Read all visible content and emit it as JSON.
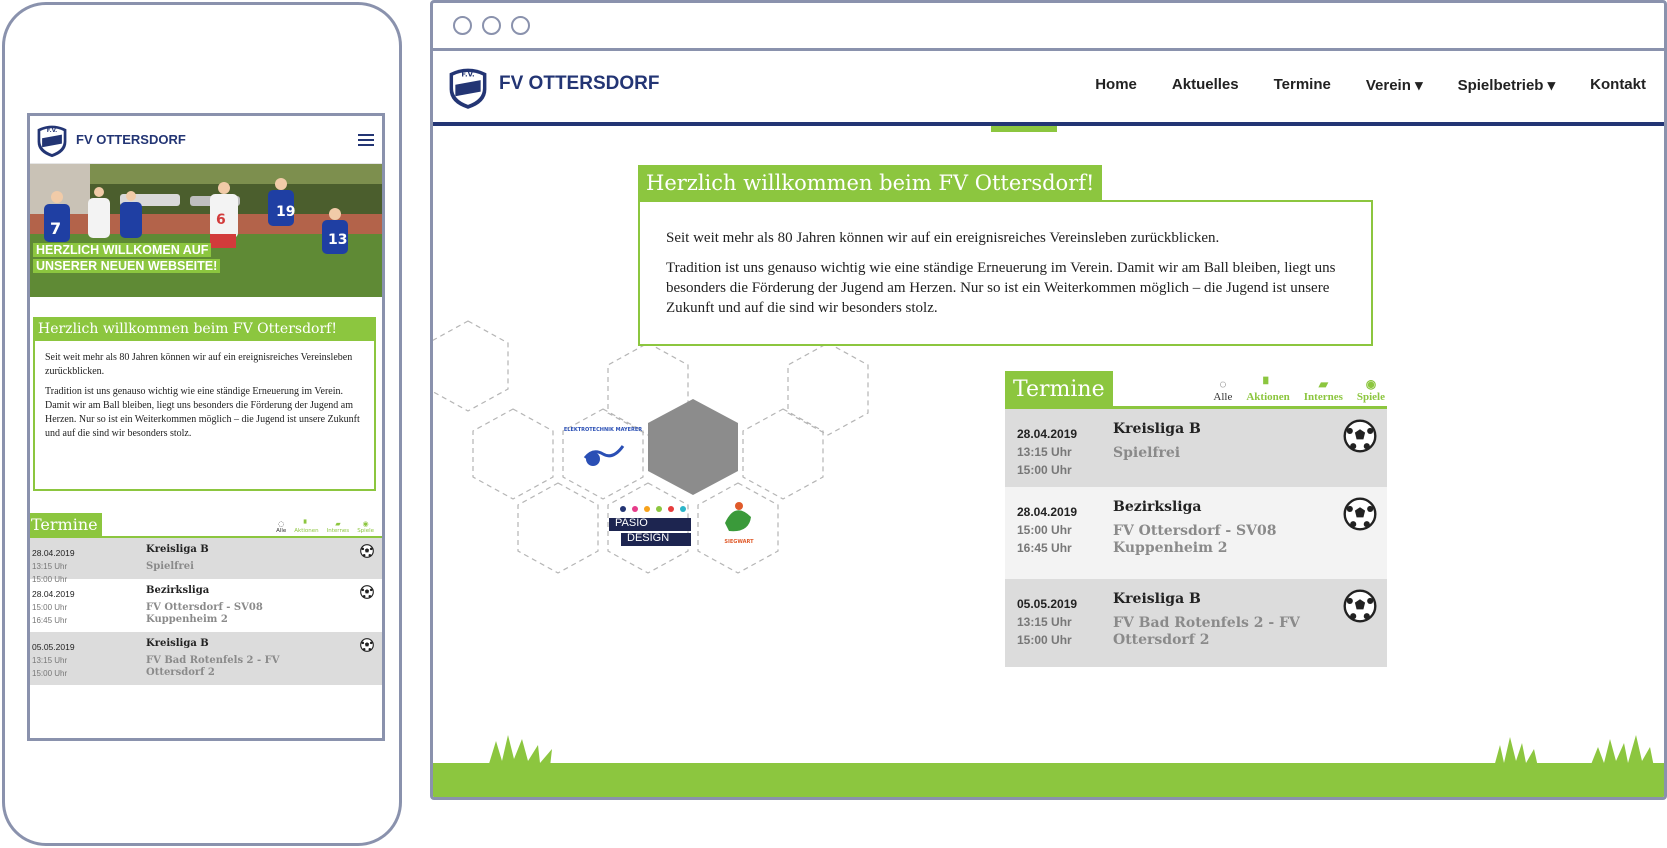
{
  "brand": {
    "name": "FV OTTERSDORF",
    "accent": "#8cc63f",
    "primary": "#233574"
  },
  "mobile": {
    "hero_title": "HERZLICH WILLKOMEN AUF UNSERER NEUEN WEBSEITE!",
    "welcome": {
      "title": "Herzlich willkommen beim FV Ottersdorf!",
      "p1": "Seit weit mehr als 80 Jahren können wir auf ein ereignisreiches Vereinsleben zurückblicken.",
      "p2": "Tradition ist uns genauso wichtig wie eine ständige Erneuerung im Verein. Damit wir am Ball bleiben, liegt uns besonders die Förderung der Jugend am Herzen. Nur so ist ein Weiterkommen möglich – die Jugend ist unsere Zukunft und auf die sind wir besonders stolz."
    },
    "termine_title": "Termine",
    "filters": [
      {
        "label": "Alle",
        "icon": "spinner-icon"
      },
      {
        "label": "Aktionen",
        "icon": "jersey-icon"
      },
      {
        "label": "Internes",
        "icon": "chat-icon"
      },
      {
        "label": "Spiele",
        "icon": "ball-icon"
      }
    ],
    "events": [
      {
        "date": "28.04.2019",
        "time1": "13:15 Uhr",
        "time2": "15:00 Uhr",
        "league": "Kreisliga B",
        "match": "Spielfrei"
      },
      {
        "date": "28.04.2019",
        "time1": "15:00 Uhr",
        "time2": "16:45 Uhr",
        "league": "Bezirksliga",
        "match": "FV Ottersdorf - SV08 Kuppenheim 2"
      },
      {
        "date": "05.05.2019",
        "time1": "13:15 Uhr",
        "time2": "15:00 Uhr",
        "league": "Kreisliga B",
        "match": "FV Bad Rotenfels 2 - FV Ottersdorf 2"
      }
    ]
  },
  "desktop": {
    "nav": [
      {
        "label": "Home"
      },
      {
        "label": "Aktuelles"
      },
      {
        "label": "Termine"
      },
      {
        "label": "Verein",
        "caret": "▾"
      },
      {
        "label": "Spielbetrieb",
        "caret": "▾"
      },
      {
        "label": "Kontakt"
      }
    ],
    "welcome": {
      "title": "Herzlich willkommen beim FV Ottersdorf!",
      "p1": "Seit weit mehr als 80 Jahren können wir auf ein ereignisreiches Vereinsleben zurückblicken.",
      "p2": "Tradition ist uns genauso wichtig wie eine ständige Erneuerung im Verein. Damit wir am Ball bleiben, liegt uns besonders die Förderung der Jugend am Herzen. Nur so ist ein Weiterkommen möglich – die Jugend ist unsere Zukunft und auf die sind wir besonders stolz."
    },
    "termine_title": "Termine",
    "filters": [
      {
        "label": "Alle",
        "icon": "spinner-icon"
      },
      {
        "label": "Aktionen",
        "icon": "jersey-icon"
      },
      {
        "label": "Internes",
        "icon": "chat-icon"
      },
      {
        "label": "Spiele",
        "icon": "ball-icon"
      }
    ],
    "events": [
      {
        "date": "28.04.2019",
        "time1": "13:15 Uhr",
        "time2": "15:00 Uhr",
        "league": "Kreisliga B",
        "match": "Spielfrei"
      },
      {
        "date": "28.04.2019",
        "time1": "15:00 Uhr",
        "time2": "16:45 Uhr",
        "league": "Bezirksliga",
        "match": "FV Ottersdorf - SV08 Kuppenheim 2"
      },
      {
        "date": "05.05.2019",
        "time1": "13:15 Uhr",
        "time2": "15:00 Uhr",
        "league": "Kreisliga B",
        "match": "FV Bad Rotenfels 2 - FV Ottersdorf 2"
      }
    ],
    "sponsors": [
      {
        "name": "PASIO",
        "name2": "DESIGN"
      }
    ]
  }
}
